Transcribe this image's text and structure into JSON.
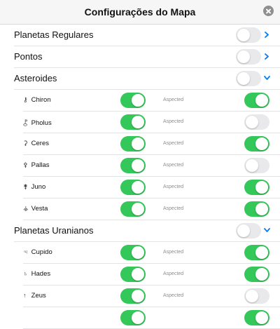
{
  "header": {
    "title": "Configurações do Mapa"
  },
  "sections": [
    {
      "label": "Planetas Regulares",
      "on": false,
      "chevron": "right"
    },
    {
      "label": "Pontos",
      "on": false,
      "chevron": "right"
    },
    {
      "label": "Asteroides",
      "on": false,
      "chevron": "down"
    }
  ],
  "asteroids": [
    {
      "glyph": "⚷",
      "name": "Chiron",
      "shown": true,
      "aspected_label": "Aspected",
      "aspected": true
    },
    {
      "glyph": "⯛",
      "name": "Pholus",
      "shown": true,
      "aspected_label": "Aspected",
      "aspected": false
    },
    {
      "glyph": "⚳",
      "name": "Ceres",
      "shown": true,
      "aspected_label": "Aspected",
      "aspected": true
    },
    {
      "glyph": "⚴",
      "name": "Pallas",
      "shown": true,
      "aspected_label": "Aspected",
      "aspected": false
    },
    {
      "glyph": "⚵",
      "name": "Juno",
      "shown": true,
      "aspected_label": "Aspected",
      "aspected": true
    },
    {
      "glyph": "⚶",
      "name": "Vesta",
      "shown": true,
      "aspected_label": "Aspected",
      "aspected": true
    }
  ],
  "uranian_section": {
    "label": "Planetas Uranianos",
    "on": false,
    "chevron": "down"
  },
  "uranians": [
    {
      "glyph": "♃",
      "name": "Cupido",
      "shown": true,
      "aspected_label": "Aspected",
      "aspected": true
    },
    {
      "glyph": "♄",
      "name": "Hades",
      "shown": true,
      "aspected_label": "Aspected",
      "aspected": true
    },
    {
      "glyph": "↑",
      "name": "Zeus",
      "shown": true,
      "aspected_label": "Aspected",
      "aspected": false
    },
    {
      "glyph": "",
      "name": "",
      "shown": true,
      "aspected_label": "",
      "aspected": true
    }
  ],
  "colors": {
    "toggle_on": "#34c759",
    "toggle_off": "#e9e9eb",
    "accent": "#007aff"
  }
}
